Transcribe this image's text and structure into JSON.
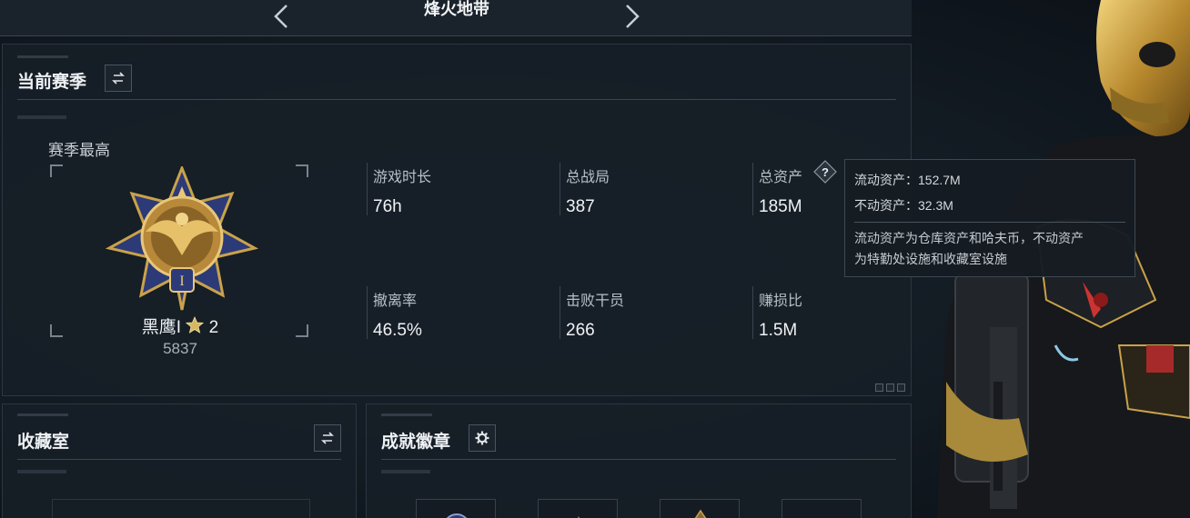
{
  "mode_bar": {
    "title": "烽火地带",
    "prev_icon": "chevron-left-icon",
    "next_icon": "chevron-right-icon"
  },
  "season_panel": {
    "title": "当前赛季",
    "switch_icon": "swap-arrows-icon",
    "best_label": "赛季最高",
    "rank_name": "黑鹰I",
    "rank_stars": "2",
    "rank_score": "5837",
    "stats": [
      {
        "label": "游戏时长",
        "value": "76h"
      },
      {
        "label": "总战局",
        "value": "387"
      },
      {
        "label": "总资产",
        "value": "185M"
      },
      {
        "label": "撤离率",
        "value": "46.5%"
      },
      {
        "label": "击败干员",
        "value": "266"
      },
      {
        "label": "赚损比",
        "value": "1.5M"
      }
    ]
  },
  "tooltip": {
    "liquid": "流动资产：152.7M",
    "fixed": "不动资产：32.3M",
    "note_line1": "流动资产为仓库资产和哈夫币，不动资产",
    "note_line2": "为特勤处设施和收藏室设施"
  },
  "collection_panel": {
    "title": "收藏室",
    "switch_icon": "swap-arrows-icon"
  },
  "achievement_panel": {
    "title": "成就徽章",
    "settings_icon": "gear-icon"
  },
  "colors": {
    "gold": "#c9a24a",
    "medal_blue": "#2c3a78",
    "panel_bg": "#161e27"
  }
}
